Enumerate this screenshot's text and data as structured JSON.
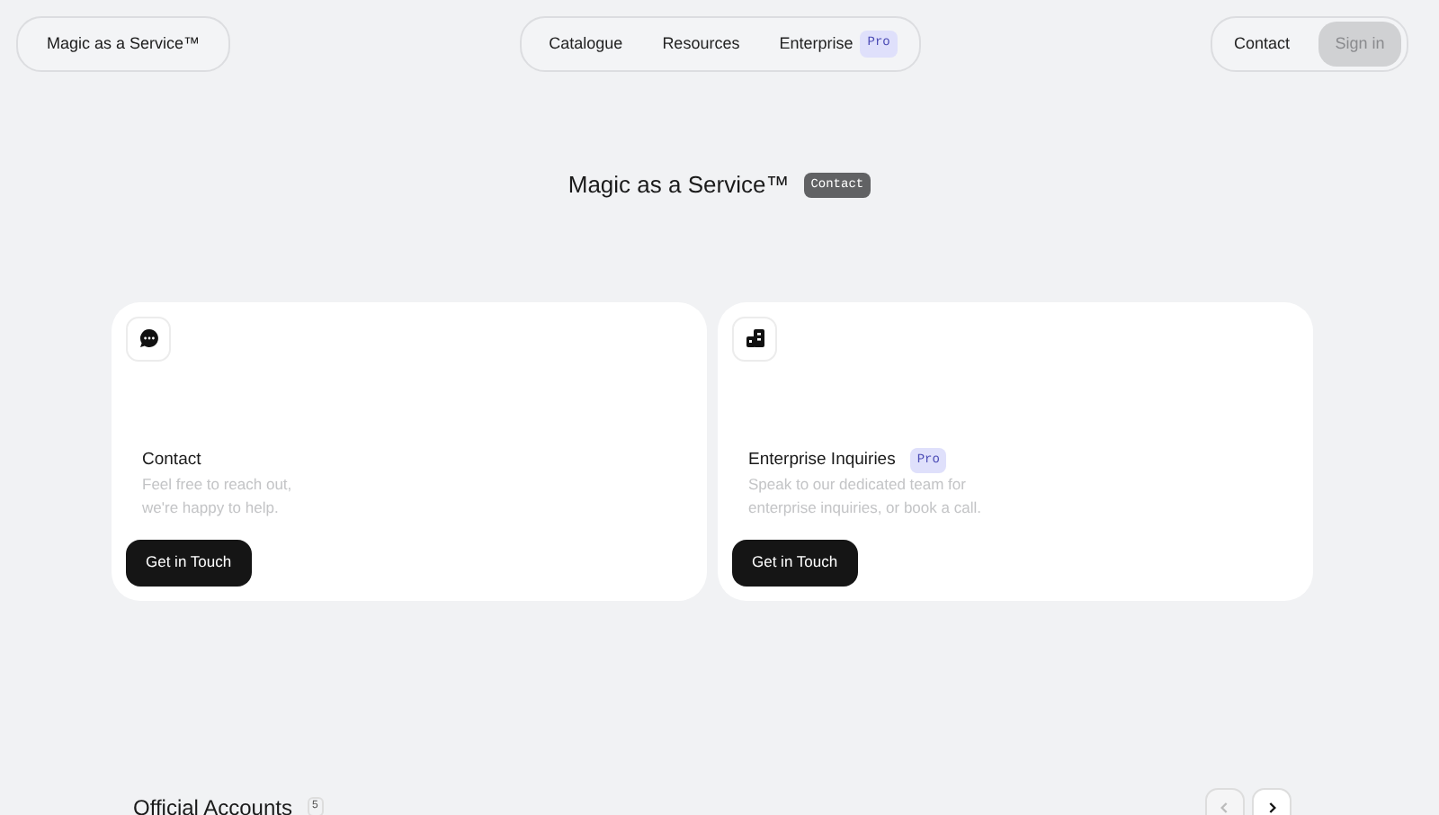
{
  "brand": "Magic as a Service™",
  "nav": [
    {
      "label": "Catalogue"
    },
    {
      "label": "Resources"
    },
    {
      "label": "Enterprise",
      "badge": "Pro"
    }
  ],
  "actions": {
    "contact": "Contact",
    "sign_in": {
      "label": "Sign in",
      "disabled": true
    }
  },
  "heading": {
    "title": "Magic as a Service™",
    "tag": "Contact"
  },
  "cards": [
    {
      "title": "Contact",
      "text": "Feel free to reach out,\nwe're happy to help.",
      "button": "Get in Touch"
    },
    {
      "title": "Enterprise Inquiries",
      "badge": "Pro",
      "text": "Speak to our dedicated team for\nenterprise inquiries, or book a call.",
      "button": "Get in Touch"
    }
  ],
  "section": {
    "title": "Official Accounts",
    "count": "5",
    "prev_disabled": true,
    "next_disabled": false
  }
}
